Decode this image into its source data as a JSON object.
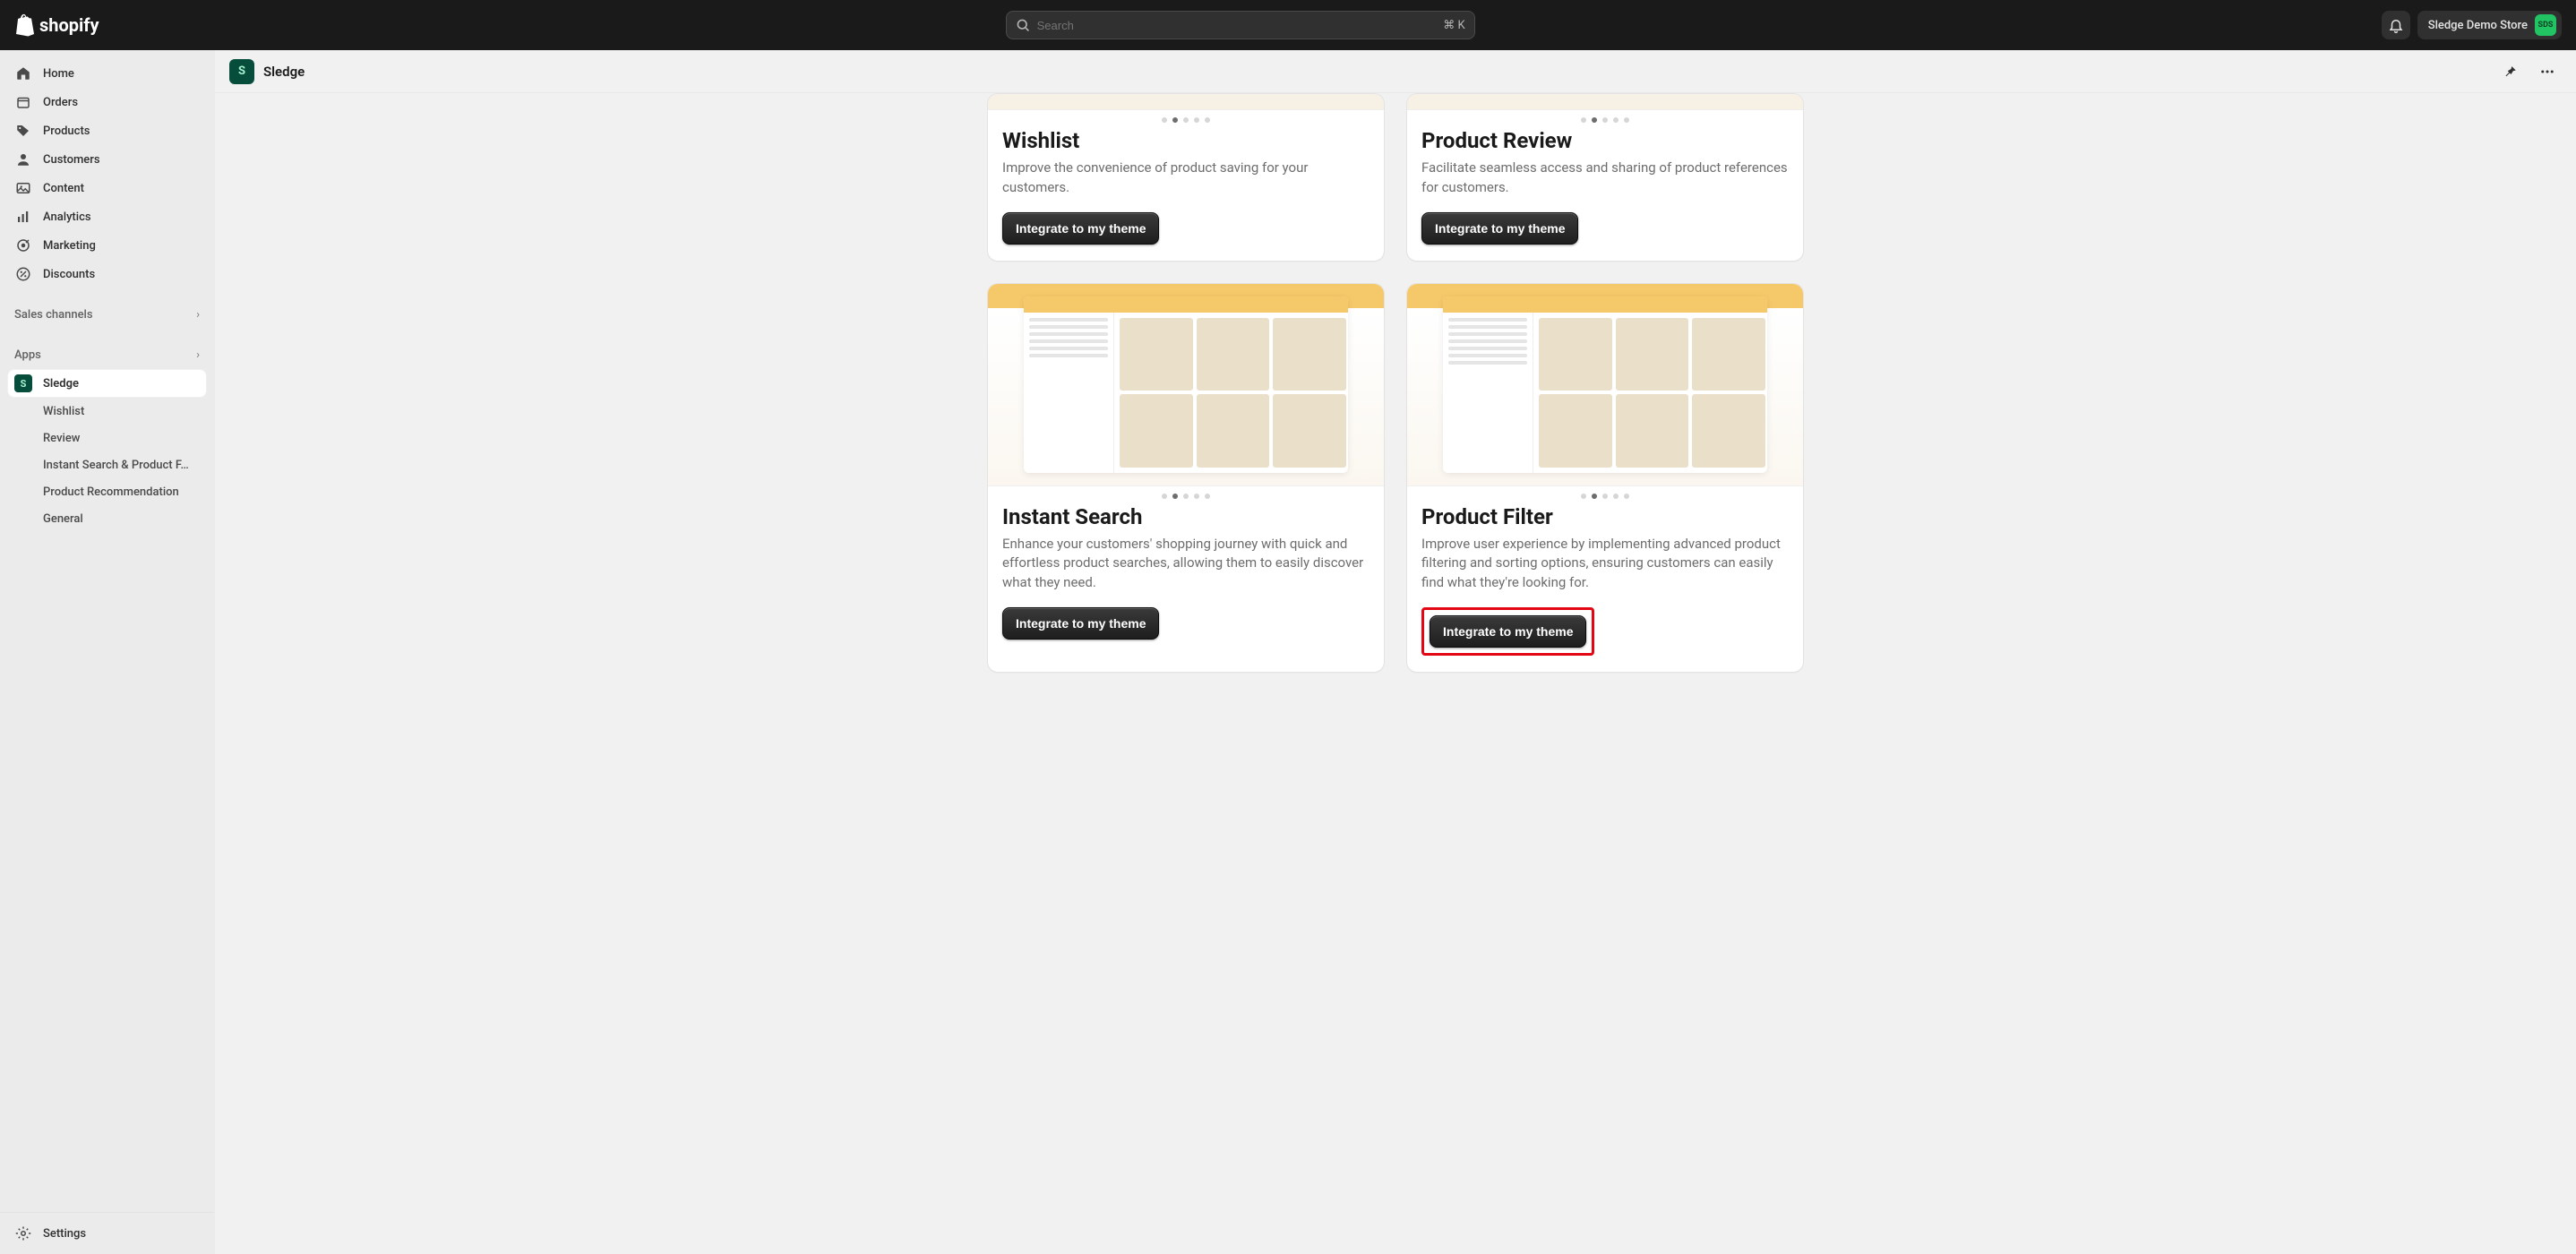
{
  "topbar": {
    "brand": "shopify",
    "search_placeholder": "Search",
    "search_shortcut": "⌘ K",
    "store_name": "Sledge Demo Store",
    "avatar_initials": "SDS"
  },
  "sidebar": {
    "nav": [
      {
        "icon": "home",
        "label": "Home"
      },
      {
        "icon": "orders",
        "label": "Orders"
      },
      {
        "icon": "tag",
        "label": "Products"
      },
      {
        "icon": "user",
        "label": "Customers"
      },
      {
        "icon": "image",
        "label": "Content"
      },
      {
        "icon": "chart",
        "label": "Analytics"
      },
      {
        "icon": "target",
        "label": "Marketing"
      },
      {
        "icon": "percent",
        "label": "Discounts"
      }
    ],
    "channels_label": "Sales channels",
    "apps_label": "Apps",
    "active_app": "Sledge",
    "sub_items": [
      "Wishlist",
      "Review",
      "Instant Search & Product F…",
      "Product Recommendation",
      "General"
    ],
    "settings_label": "Settings"
  },
  "page_header": {
    "app_name": "Sledge"
  },
  "cards": {
    "wishlist": {
      "title": "Wishlist",
      "desc": "Improve the convenience of product saving for your customers.",
      "button": "Integrate to my theme"
    },
    "product_review": {
      "title": "Product Review",
      "desc": "Facilitate seamless access and sharing of product references for customers.",
      "button": "Integrate to my theme"
    },
    "instant_search": {
      "title": "Instant Search",
      "desc": "Enhance your customers' shopping journey with quick and effortless product searches, allowing them to easily discover what they need.",
      "button": "Integrate to my theme"
    },
    "product_filter": {
      "title": "Product Filter",
      "desc": "Improve user experience by implementing advanced product filtering and sorting options, ensuring customers can easily find what they're looking for.",
      "button": "Integrate to my theme"
    }
  }
}
